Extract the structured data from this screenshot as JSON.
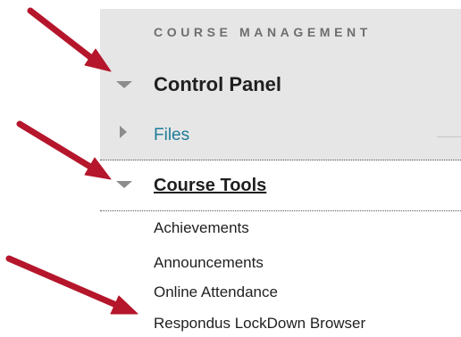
{
  "colors": {
    "panel_background": "#e6e6e6",
    "arrow": "#b5162b",
    "link": "#1d7c97",
    "triangle": "#8c8c8c"
  },
  "menu": {
    "section_header": "COURSE MANAGEMENT",
    "control_panel": {
      "label": "Control Panel",
      "state": "expanded",
      "icon": "triangle-down-icon"
    },
    "files": {
      "label": "Files",
      "state": "collapsed",
      "icon": "triangle-right-icon"
    },
    "course_tools": {
      "label": "Course Tools",
      "state": "expanded",
      "icon": "triangle-down-icon",
      "items": [
        {
          "label": "Achievements"
        },
        {
          "label": "Announcements"
        },
        {
          "label": "Online Attendance"
        },
        {
          "label": "Respondus LockDown Browser"
        }
      ]
    }
  },
  "annotations": {
    "arrows": [
      {
        "points_to": "control-panel-toggle"
      },
      {
        "points_to": "course-tools-toggle"
      },
      {
        "points_to": "respondus-lockdown-browser-link"
      }
    ]
  }
}
